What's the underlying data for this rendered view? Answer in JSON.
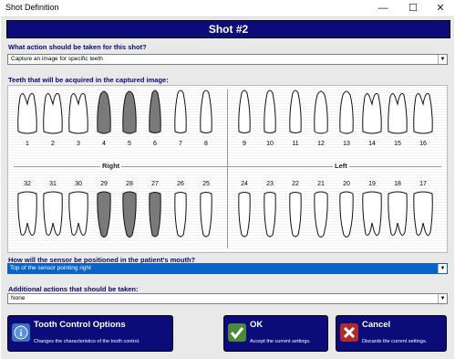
{
  "window": {
    "title": "Shot Definition",
    "controls": {
      "minimize": "—",
      "maximize": "☐",
      "close": "✕"
    }
  },
  "banner": {
    "title": "Shot #2"
  },
  "action": {
    "question": "What action should be taken for this shot?",
    "value": "Capture an image for specific teeth"
  },
  "teeth": {
    "question": "Teeth that will be acquired in the captured image:",
    "right_label": "Right",
    "left_label": "Left",
    "upper_numbers": [
      "1",
      "2",
      "3",
      "4",
      "5",
      "6",
      "7",
      "8",
      "9",
      "10",
      "11",
      "12",
      "13",
      "14",
      "15",
      "16"
    ],
    "lower_numbers": [
      "32",
      "31",
      "30",
      "29",
      "28",
      "27",
      "26",
      "25",
      "24",
      "23",
      "22",
      "21",
      "20",
      "19",
      "18",
      "17"
    ],
    "selected": [
      "4",
      "5",
      "6",
      "29",
      "28",
      "27"
    ],
    "selected_color": "#7a7a7a"
  },
  "sensor": {
    "question": "How will the sensor be positioned in the patient's mouth?",
    "value": "Top of the sensor pointing right"
  },
  "additional": {
    "question": "Additional actions that should be taken:",
    "value": "None"
  },
  "buttons": {
    "tooth_control": {
      "label": "Tooth Control Options",
      "desc": "Changes the characteristics of the tooth control."
    },
    "ok": {
      "label": "OK",
      "desc": "Accept the current settings."
    },
    "cancel": {
      "label": "Cancel",
      "desc": "Discards the current settings."
    }
  },
  "icons": {
    "info": "info-icon",
    "check": "check-icon",
    "x": "x-icon"
  }
}
